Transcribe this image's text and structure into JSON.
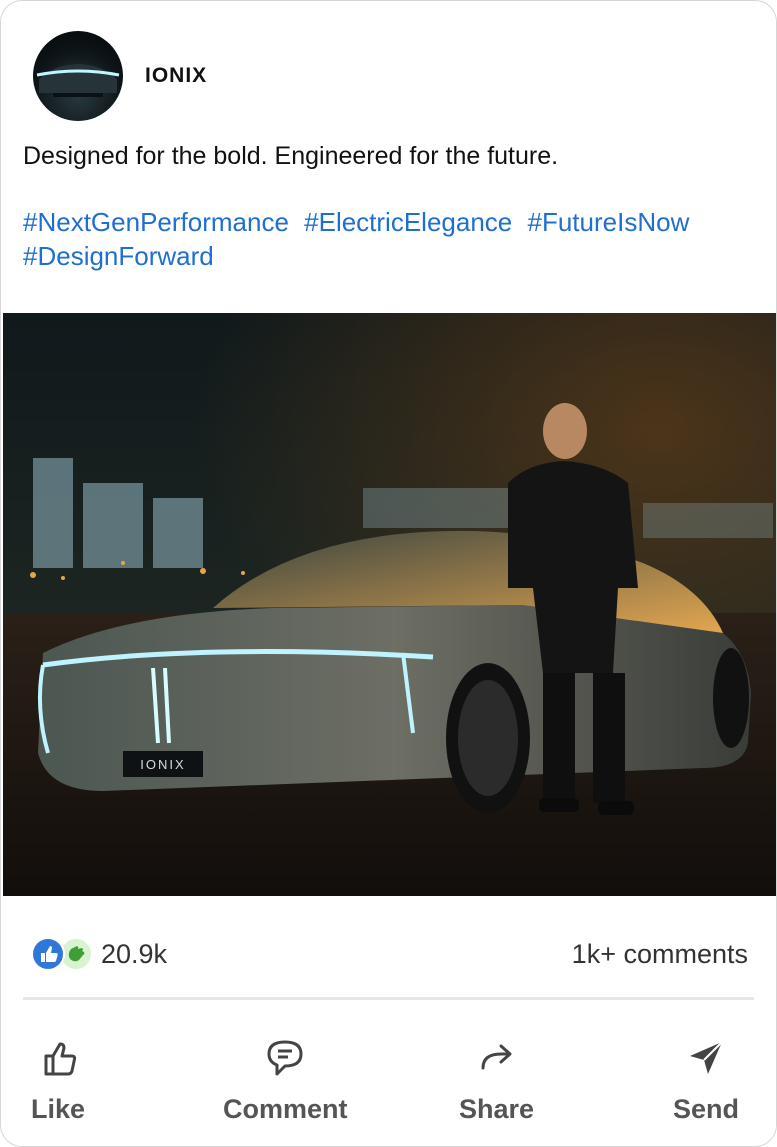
{
  "post": {
    "author": "IONIX",
    "caption": "Designed for the bold. Engineered for the future.",
    "hashtags": [
      "#NextGenPerformance",
      "#ElectricElegance",
      "#FutureIsNow",
      "#DesignForward"
    ],
    "image": {
      "alt": "IONIX electric car at night with a man standing beside it",
      "badge_text": "IONIX"
    }
  },
  "stats": {
    "reaction_icons": [
      "like-icon",
      "clap-icon"
    ],
    "reaction_count": "20.9k",
    "comments": "1k+ comments"
  },
  "actions": {
    "like": "Like",
    "comment": "Comment",
    "share": "Share",
    "send": "Send"
  },
  "colors": {
    "hashtag": "#1f6fd0",
    "like_badge": "#2f78d8"
  }
}
